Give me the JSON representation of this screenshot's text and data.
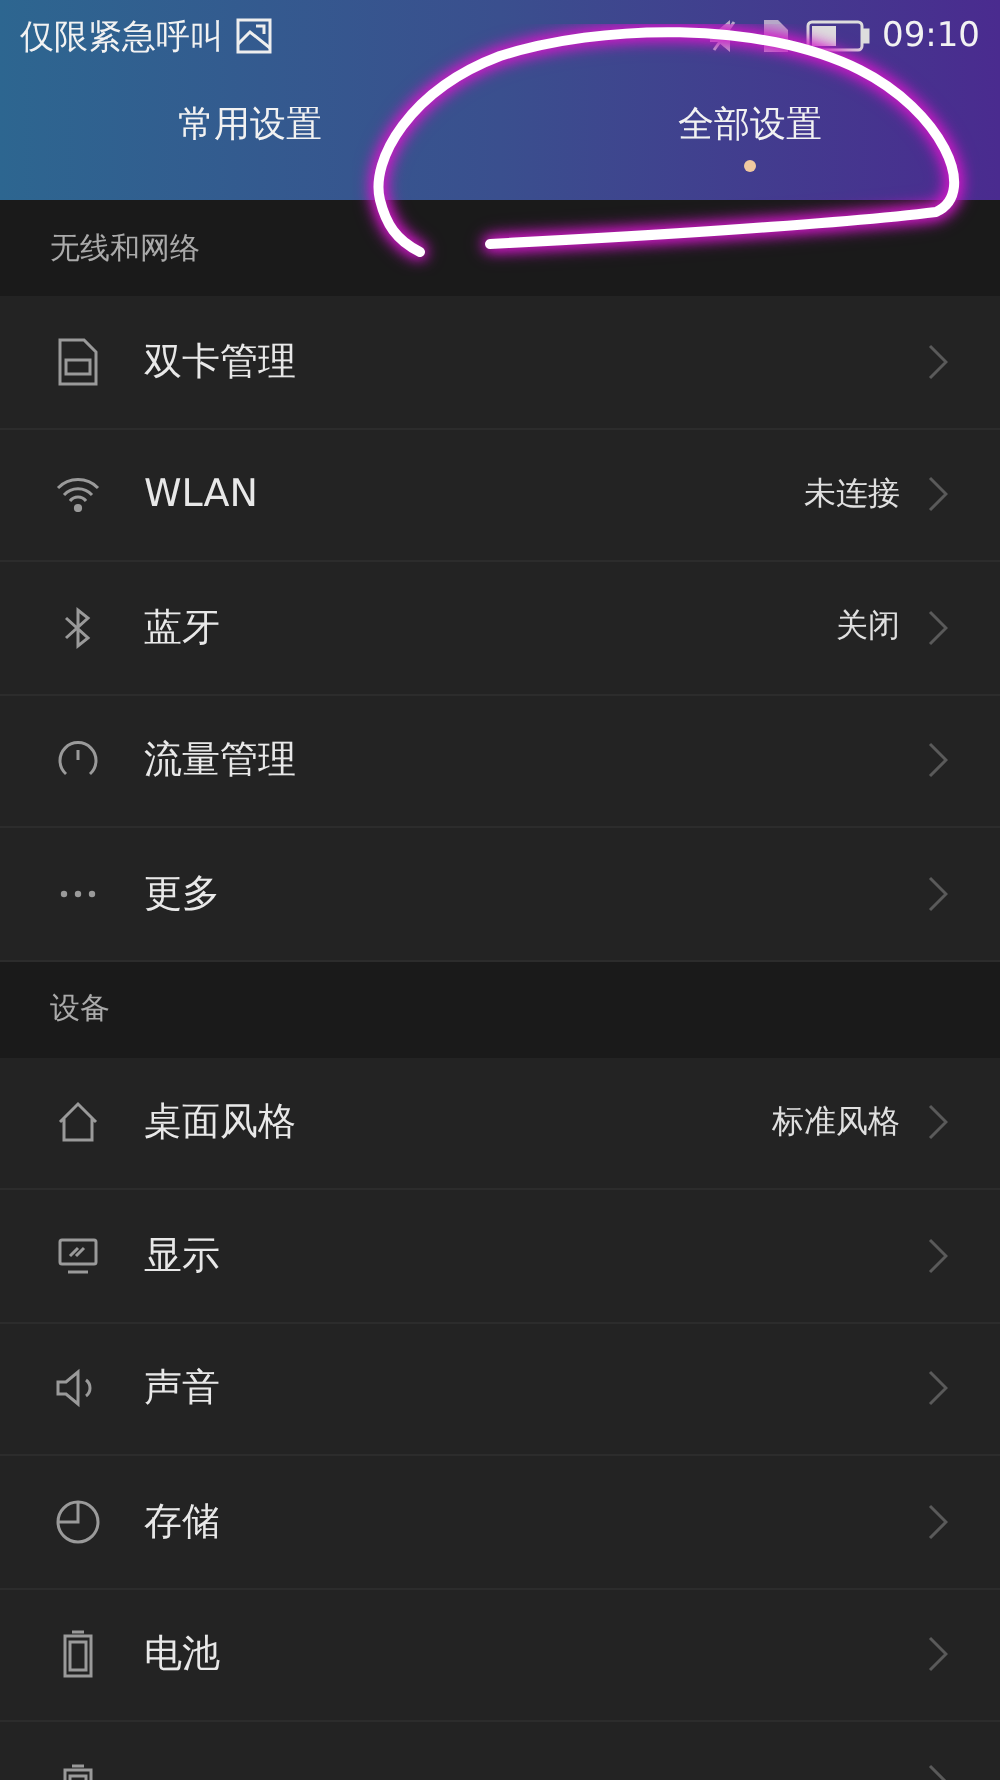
{
  "status_bar": {
    "carrier": "仅限紧急呼叫",
    "time": "09:10"
  },
  "tabs": [
    {
      "label": "常用设置",
      "selected": false
    },
    {
      "label": "全部设置",
      "selected": true
    }
  ],
  "sections": [
    {
      "title": "无线和网络",
      "items": [
        {
          "label": "双卡管理"
        },
        {
          "label": "WLAN",
          "value": "未连接"
        },
        {
          "label": "蓝牙",
          "value": "关闭"
        },
        {
          "label": "流量管理"
        },
        {
          "label": "更多"
        }
      ]
    },
    {
      "title": "设备",
      "items": [
        {
          "label": "桌面风格",
          "value": "标准风格"
        },
        {
          "label": "显示"
        },
        {
          "label": "声音"
        },
        {
          "label": "存储"
        },
        {
          "label": "电池"
        }
      ]
    }
  ]
}
